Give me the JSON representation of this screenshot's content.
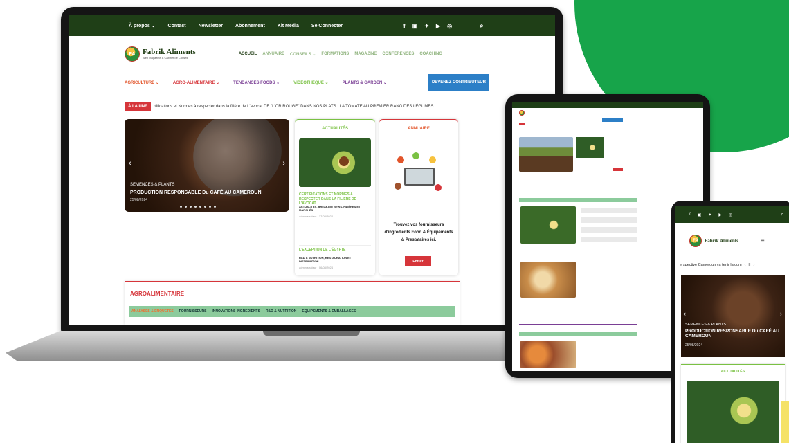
{
  "laptop": {
    "topbar": {
      "links": [
        "À propos ⌄",
        "Contact",
        "Newsletter",
        "Abonnement",
        "Kit Média",
        "Se Connecter"
      ],
      "social": [
        "f",
        "▣",
        "✦",
        "▶",
        "◎"
      ]
    },
    "logo": {
      "mark": "FA",
      "name": "Fabrik Aliments",
      "tagline": "Web Magazine & Cabinet de Conseil"
    },
    "main_nav": [
      "ACCUEIL",
      "ANNUAIRE",
      "CONSEILS ⌄",
      "FORMATIONS",
      "MAGAZINE",
      "CONFÉRENCES",
      "COACHING"
    ],
    "category_nav": [
      "AGRICULTURE ⌄",
      "AGRO-ALIMENTAIRE ⌄",
      "TENDANCES FOODS ⌄",
      "VIDÉOTHÈQUE ⌄",
      "PLANTS & GARDEN ⌄"
    ],
    "cta": "DEVENEZ CONTRIBUTEUR",
    "ticker": {
      "tag": "À LA UNE",
      "text": "rtifications et Normes à respecter dans la filière de L'avocat   DE \"L'OR ROUGE\" DANS NOS PLATS : LA TOMATE AU PREMIER RANG DES LÉGUMES"
    },
    "slider": {
      "category": "SEMENCES & PLANTS",
      "title": "PRODUCTION RESPONSABLE Du CAFÉ AU CAMEROUN",
      "date": "25/08/2024",
      "prev": "‹",
      "next": "›"
    },
    "actualites": {
      "title": "ACTUALITÉS",
      "item1_title": "CERTIFICATIONS ET NORMES À RESPECTER DANS LA FILIÈRE DE L'AVOCAT",
      "item1_cats": "ACTUALITÉS, BREAKING NEWS, FILIÈRES ET MARCHÉS",
      "item1_meta": "administrateur · 17/08/2024",
      "item2_title": "L'EXCEPTION DE L'ÉGYPTE :",
      "item2_cats": "R&D & NUTRITION, RESTAURATION ET DISTRIBUTION",
      "item2_meta": "administrateur · 06/08/2024"
    },
    "annuaire": {
      "title": "ANNUAIRE",
      "text": "Trouvez vos fournisseurs d'ingrédients Food & Équipements & Prestataires ici.",
      "button": "Entrez"
    },
    "agro": {
      "title": "AGROALIMENTAIRE",
      "tabs": [
        "ANALYSES & ENQUÊTES",
        "FOURNISSEURS",
        "INNOVATIONS INGRÉDIENTS",
        "R&D & NUTRITION",
        "ÉQUIPEMENTS & EMBALLAGES"
      ]
    }
  },
  "phone": {
    "topbar_social": [
      "f",
      "▣",
      "✦",
      "▶",
      "◎"
    ],
    "menu_icon": "≡",
    "ticker_text": "erspective   Cameroun va tenir la com",
    "ticker_controls": [
      "‹",
      "II",
      "›"
    ],
    "slider": {
      "category": "SEMENCES & PLANTS",
      "title": "PRODUCTION RESPONSABLE Du CAFÉ AU CAMEROUN",
      "date": "25/08/2024"
    },
    "card_title": "ACTUALITÉS"
  },
  "colors": {
    "brand_green": "#17a44a",
    "dark_green": "#1f3f17",
    "red": "#d6353a",
    "blue": "#2c7fc7",
    "light_green": "#7ac143"
  }
}
